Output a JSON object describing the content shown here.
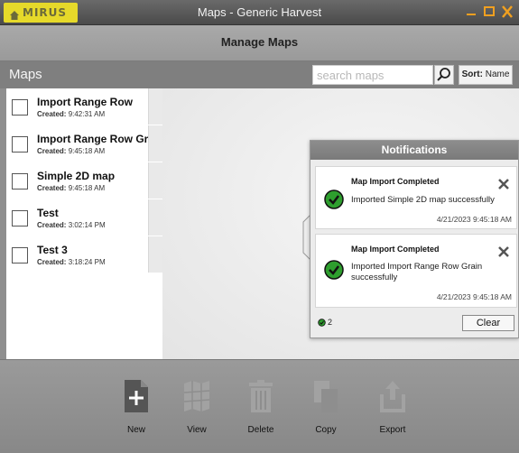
{
  "window": {
    "logo_text": "MIRUS",
    "title": "Maps - Generic Harvest"
  },
  "header": {
    "title": "Manage Maps"
  },
  "maps_bar": {
    "label": "Maps",
    "search_placeholder": "search maps",
    "sort_prefix": "Sort:",
    "sort_value": "Name"
  },
  "maps": [
    {
      "name": "Import Range Row",
      "created_label": "Created:",
      "created": "9:42:31 AM"
    },
    {
      "name": "Import Range Row Gra...",
      "created_label": "Created:",
      "created": "9:45:18 AM"
    },
    {
      "name": "Simple 2D map",
      "created_label": "Created:",
      "created": "9:45:18 AM"
    },
    {
      "name": "Test",
      "created_label": "Created:",
      "created": "3:02:14 PM"
    },
    {
      "name": "Test 3",
      "created_label": "Created:",
      "created": "3:18:24 PM"
    }
  ],
  "notifications": {
    "title": "Notifications",
    "items": [
      {
        "title": "Map Import Completed",
        "message": "Imported Simple 2D map successfully",
        "date": "4/21/2023 9:45:18 AM"
      },
      {
        "title": "Map Import Completed",
        "message": "Imported Import Range Row Grain successfully",
        "date": "4/21/2023 9:45:18 AM"
      }
    ],
    "count": "2",
    "clear_label": "Clear"
  },
  "toolbar": {
    "new": "New",
    "view": "View",
    "delete": "Delete",
    "copy": "Copy",
    "export": "Export"
  },
  "colors": {
    "logo_bg": "#e6d92a",
    "close_accent": "#f0a020",
    "check_green": "#2e9e2e"
  }
}
